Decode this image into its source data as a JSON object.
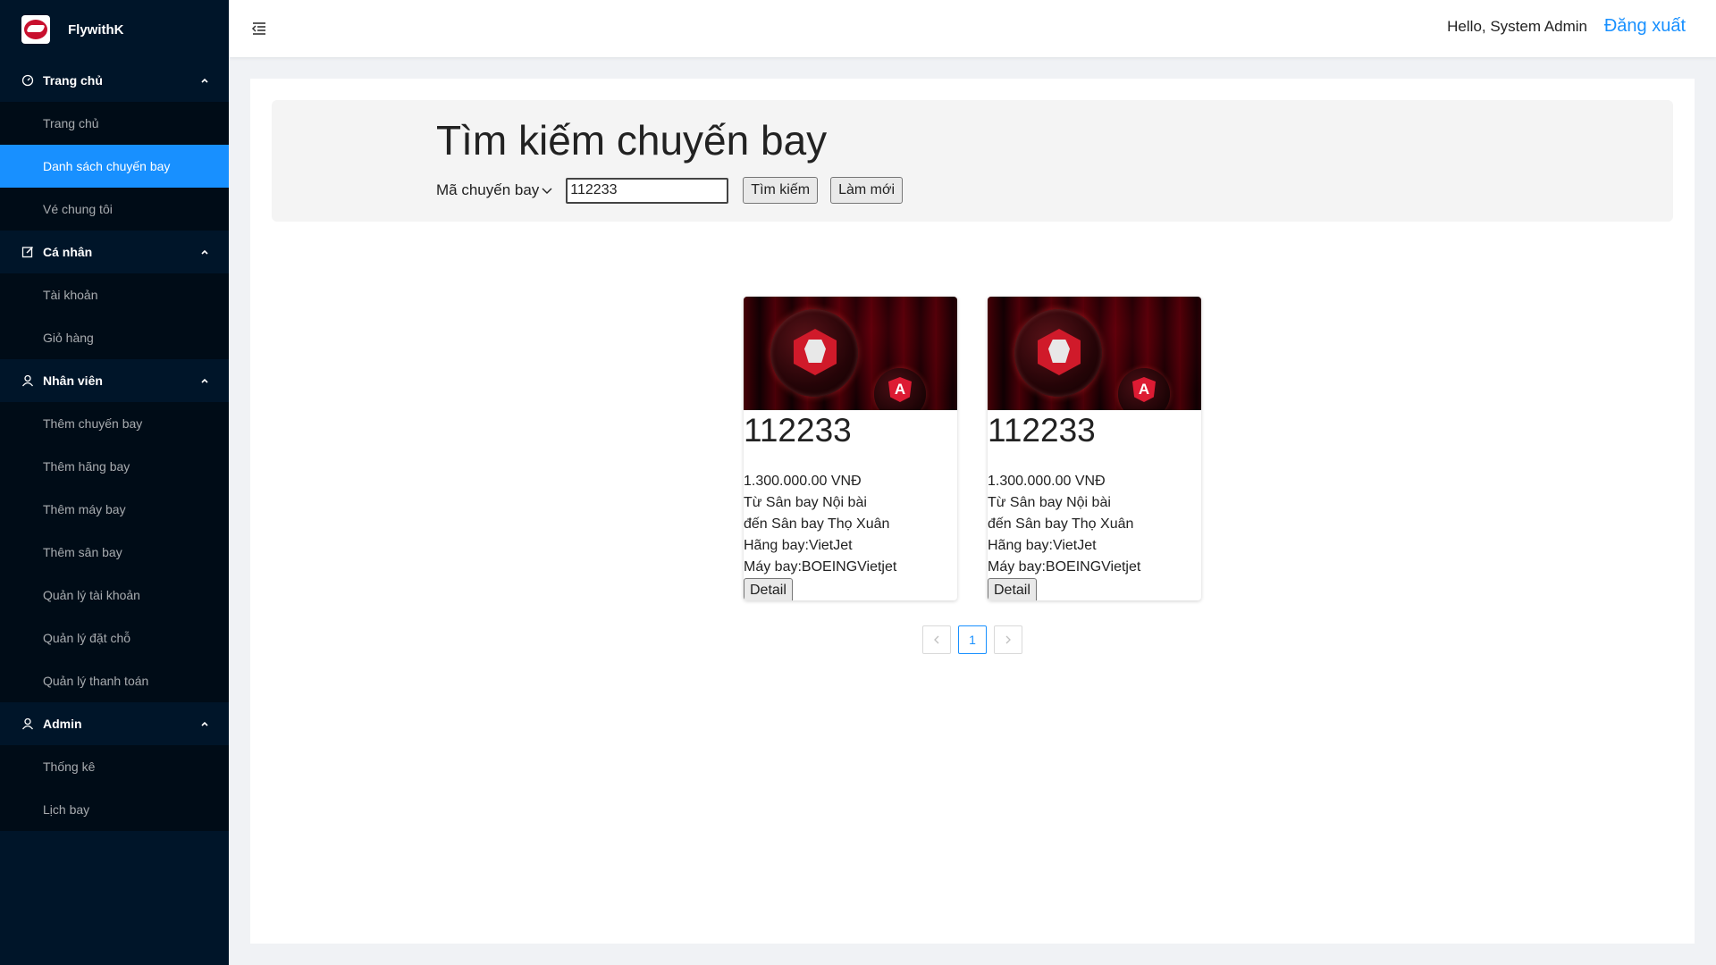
{
  "app": {
    "name": "FlywithK"
  },
  "sidebar": {
    "groups": [
      {
        "title": "Trang chủ",
        "icon": "dashboard-icon",
        "items": [
          "Trang chủ",
          "Danh sách chuyến bay",
          "Vé chung tôi"
        ]
      },
      {
        "title": "Cá nhân",
        "icon": "edit-icon",
        "items": [
          "Tài khoản",
          "Giỏ hàng"
        ]
      },
      {
        "title": "Nhân viên",
        "icon": "user-icon",
        "items": [
          "Thêm chuyến bay",
          "Thêm hãng bay",
          "Thêm máy bay",
          "Thêm sân bay",
          "Quản lý tài khoản",
          "Quản lý đặt chỗ",
          "Quản lý thanh toán"
        ]
      },
      {
        "title": "Admin",
        "icon": "user-icon",
        "items": [
          "Thống kê",
          "Lịch bay"
        ]
      }
    ],
    "active_item": "Danh sách chuyến bay"
  },
  "header": {
    "greeting": "Hello, System Admin",
    "logout_label": "Đăng xuất"
  },
  "search": {
    "title": "Tìm kiếm chuyến bay",
    "field_label": "Mã chuyến bay",
    "value": "112233",
    "search_label": "Tìm kiếm",
    "reset_label": "Làm mới"
  },
  "flights": [
    {
      "code": "112233",
      "price": "1.300.000.00 VNĐ",
      "from": "Từ Sân bay Nội bài",
      "to": "đến Sân bay Thọ Xuân",
      "airline": "Hãng bay:VietJet",
      "plane": "Máy bay:BOEINGVietjet",
      "detail_label": "Detail"
    },
    {
      "code": "112233",
      "price": "1.300.000.00 VNĐ",
      "from": "Từ Sân bay Nội bài",
      "to": "đến Sân bay Thọ Xuân",
      "airline": "Hãng bay:VietJet",
      "plane": "Máy bay:BOEINGVietjet",
      "detail_label": "Detail"
    }
  ],
  "pagination": {
    "current": "1",
    "prev_icon": "chevron-left-icon",
    "next_icon": "chevron-right-icon"
  },
  "colors": {
    "sidebar": "#001529",
    "submenu": "#000c17",
    "accent": "#1890ff"
  }
}
